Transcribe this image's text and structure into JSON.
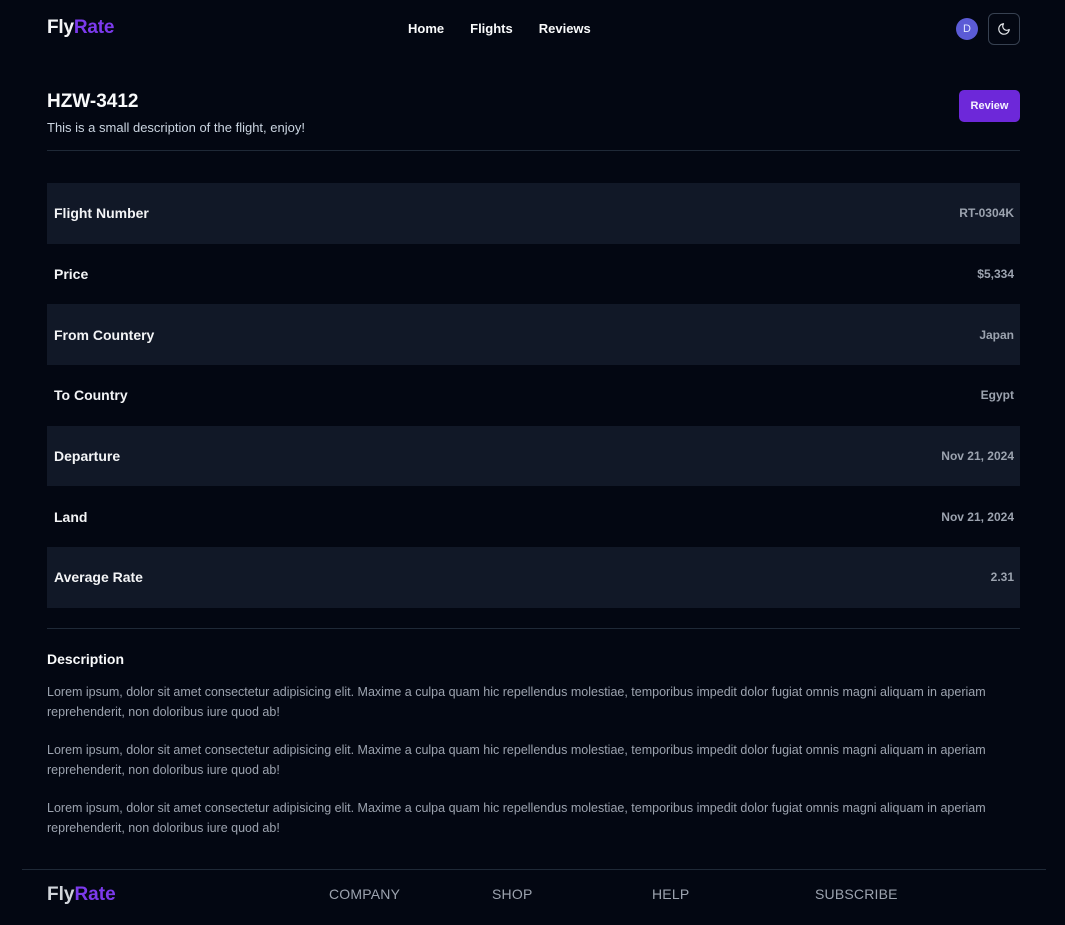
{
  "header": {
    "logo_part1": "Fly",
    "logo_part2": "Rate",
    "nav": [
      "Home",
      "Flights",
      "Reviews"
    ],
    "avatar_initial": "D",
    "theme_icon": "moon-icon"
  },
  "flight": {
    "title": "HZW-3412",
    "subtitle": "This is a small description of the flight, enjoy!",
    "review_label": "Review"
  },
  "details": [
    {
      "label": "Flight Number",
      "value": "RT-0304K"
    },
    {
      "label": "Price",
      "value": "$5,334"
    },
    {
      "label": "From Countery",
      "value": "Japan"
    },
    {
      "label": "To Country",
      "value": "Egypt"
    },
    {
      "label": "Departure",
      "value": "Nov 21, 2024"
    },
    {
      "label": "Land",
      "value": "Nov 21, 2024"
    },
    {
      "label": "Average Rate",
      "value": "2.31"
    }
  ],
  "description": {
    "heading": "Description",
    "paragraphs": [
      "Lorem ipsum, dolor sit amet consectetur adipisicing elit. Maxime a culpa quam hic repellendus molestiae, temporibus impedit dolor fugiat omnis magni aliquam in aperiam reprehenderit, non doloribus iure quod ab!",
      "Lorem ipsum, dolor sit amet consectetur adipisicing elit. Maxime a culpa quam hic repellendus molestiae, temporibus impedit dolor fugiat omnis magni aliquam in aperiam reprehenderit, non doloribus iure quod ab!",
      "Lorem ipsum, dolor sit amet consectetur adipisicing elit. Maxime a culpa quam hic repellendus molestiae, temporibus impedit dolor fugiat omnis magni aliquam in aperiam reprehenderit, non doloribus iure quod ab!"
    ]
  },
  "footer": {
    "logo_part1": "Fly",
    "logo_part2": "Rate",
    "columns": [
      "COMPANY",
      "SHOP",
      "HELP",
      "SUBSCRIBE"
    ]
  },
  "colors": {
    "background": "#030712",
    "accent": "#7c3aed",
    "button": "#6d28d9",
    "row_shade": "#111827"
  }
}
